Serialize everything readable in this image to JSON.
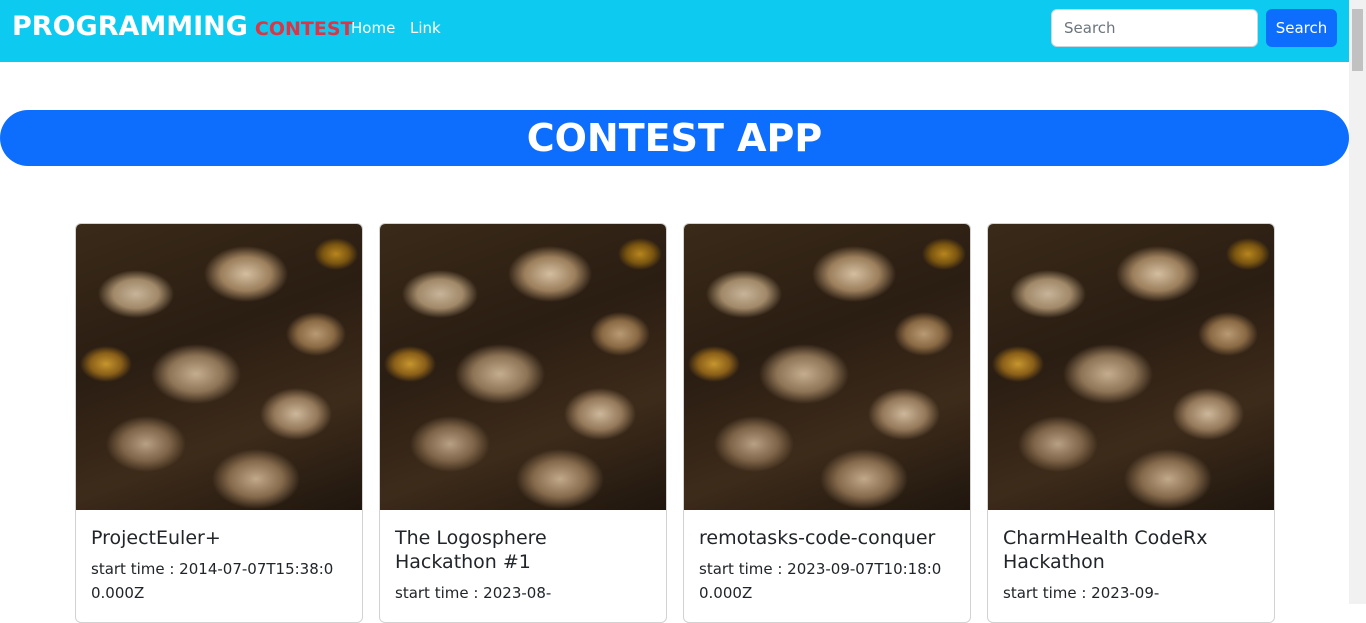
{
  "navbar": {
    "brand_main": "PROGRAMMING",
    "brand_accent": "CONTEST",
    "links": [
      "Home",
      "Link"
    ],
    "search_placeholder": "Search",
    "search_button": "Search"
  },
  "banner": {
    "title": "CONTEST APP"
  },
  "cards": [
    {
      "title": "ProjectEuler+",
      "start_label": "start time : 2014-07-07T15:38:00.000Z"
    },
    {
      "title": "The Logosphere Hackathon #1",
      "start_label": "start time : 2023-08-"
    },
    {
      "title": "remotasks-code-conquer",
      "start_label": "start time : 2023-09-07T10:18:00.000Z"
    },
    {
      "title": "CharmHealth CodeRx Hackathon",
      "start_label": "start time : 2023-09-"
    }
  ],
  "colors": {
    "navbar_bg": "#0dcaf0",
    "brand_accent": "#dc3545",
    "primary": "#0d6efd"
  }
}
